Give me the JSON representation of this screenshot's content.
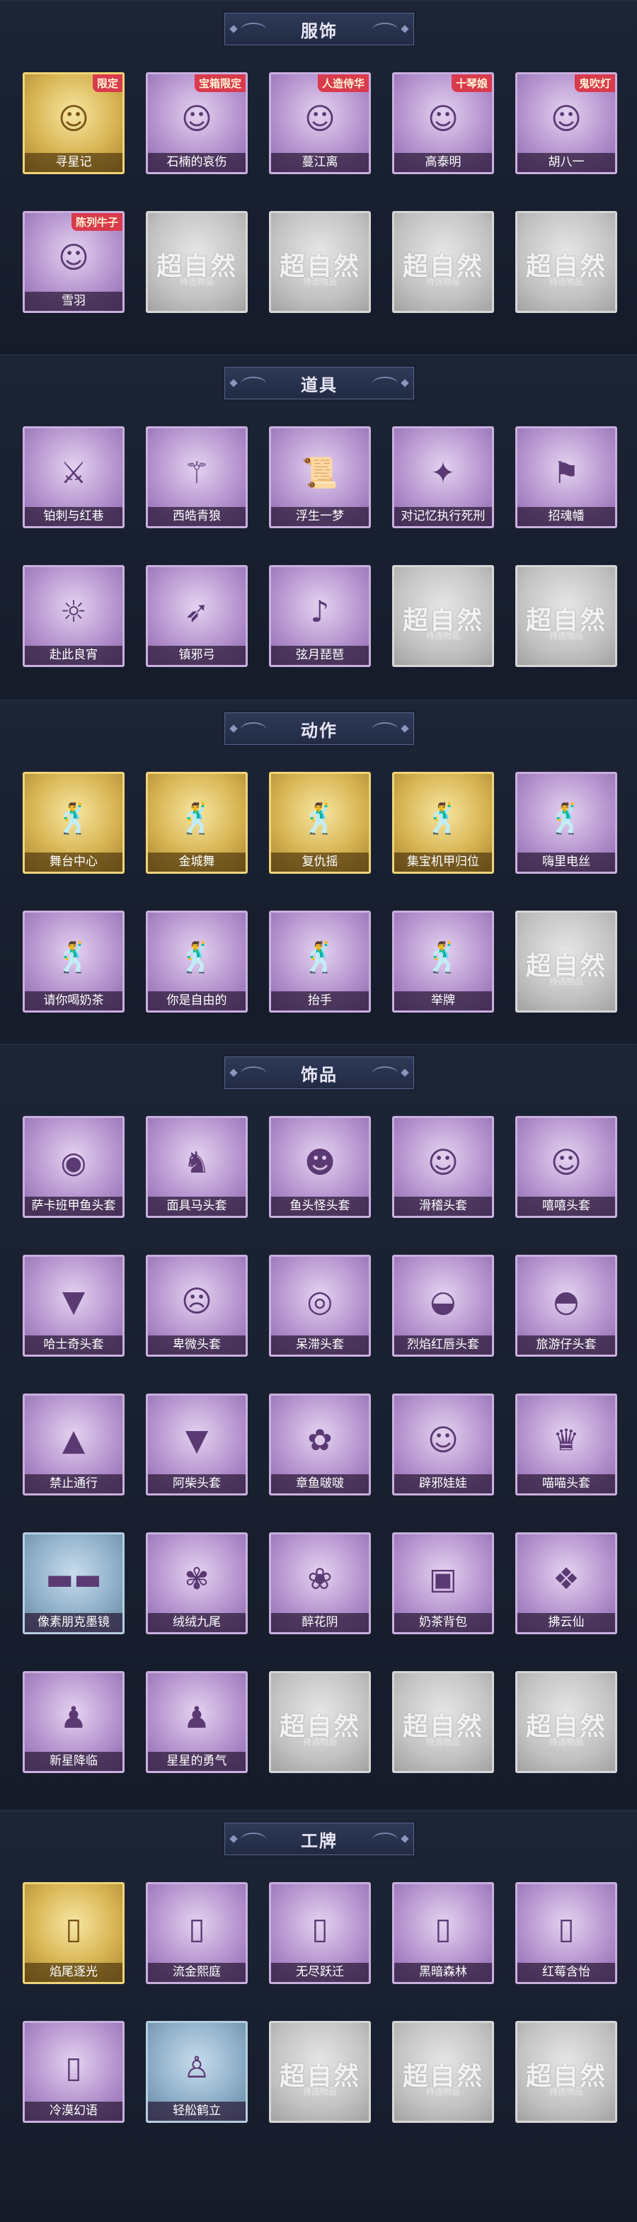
{
  "sections": [
    {
      "title": "服饰",
      "items": [
        {
          "label": "寻星记",
          "tier": "gold",
          "badge": "限定",
          "icon": "costume-portrait-icon"
        },
        {
          "label": "石楠的哀伤",
          "tier": "purple",
          "badge": "宝箱限定",
          "icon": "costume-portrait-icon"
        },
        {
          "label": "蔓江离",
          "tier": "purple",
          "badge": "人造侍华",
          "icon": "costume-portrait-icon"
        },
        {
          "label": "高泰明",
          "tier": "purple",
          "badge": "十琴娘",
          "icon": "costume-portrait-icon"
        },
        {
          "label": "胡八一",
          "tier": "purple",
          "badge": "鬼吹灯",
          "icon": "costume-portrait-icon"
        },
        {
          "label": "雪羽",
          "tier": "purple",
          "badge": "陈列牛子",
          "icon": "costume-portrait-icon"
        },
        {
          "label": "",
          "tier": "gray"
        },
        {
          "label": "",
          "tier": "gray"
        },
        {
          "label": "",
          "tier": "gray"
        },
        {
          "label": "",
          "tier": "gray"
        }
      ]
    },
    {
      "title": "道具",
      "items": [
        {
          "label": "铂刺与红巷",
          "tier": "purple",
          "icon": "blade-icon"
        },
        {
          "label": "西皓青狼",
          "tier": "purple",
          "icon": "staff-icon"
        },
        {
          "label": "浮生一梦",
          "tier": "purple",
          "icon": "scroll-icon"
        },
        {
          "label": "对记忆执行死刑",
          "tier": "purple",
          "icon": "gun-icon"
        },
        {
          "label": "招魂幡",
          "tier": "purple",
          "icon": "banner-icon"
        },
        {
          "label": "赴此良宵",
          "tier": "purple",
          "icon": "lantern-icon"
        },
        {
          "label": "镇邪弓",
          "tier": "purple",
          "icon": "bow-icon"
        },
        {
          "label": "弦月琵琶",
          "tier": "purple",
          "icon": "pipa-icon"
        },
        {
          "label": "",
          "tier": "gray"
        },
        {
          "label": "",
          "tier": "gray"
        }
      ]
    },
    {
      "title": "动作",
      "items": [
        {
          "label": "舞台中心",
          "tier": "gold",
          "icon": "pose-figure-icon"
        },
        {
          "label": "金城舞",
          "tier": "gold",
          "icon": "pose-figure-icon"
        },
        {
          "label": "复仇摇",
          "tier": "gold",
          "icon": "pose-figure-icon"
        },
        {
          "label": "集宝机甲归位",
          "tier": "gold",
          "icon": "pose-figure-icon"
        },
        {
          "label": "嗨里电丝",
          "tier": "purple",
          "icon": "pose-figure-icon"
        },
        {
          "label": "请你喝奶茶",
          "tier": "purple",
          "icon": "pose-figure-icon"
        },
        {
          "label": "你是自由的",
          "tier": "purple",
          "icon": "pose-figure-icon"
        },
        {
          "label": "抬手",
          "tier": "purple",
          "icon": "pose-figure-icon"
        },
        {
          "label": "举牌",
          "tier": "purple",
          "icon": "pose-figure-icon"
        },
        {
          "label": "",
          "tier": "gray"
        }
      ]
    },
    {
      "title": "饰品",
      "items": [
        {
          "label": "萨卡班甲鱼头套",
          "tier": "purple",
          "icon": "fish-head-icon"
        },
        {
          "label": "面具马头套",
          "tier": "purple",
          "icon": "horse-head-icon"
        },
        {
          "label": "鱼头怪头套",
          "tier": "purple",
          "icon": "fish-monster-head-icon"
        },
        {
          "label": "滑稽头套",
          "tier": "purple",
          "icon": "funny-face-icon"
        },
        {
          "label": "嘻嘻头套",
          "tier": "purple",
          "icon": "grin-face-icon"
        },
        {
          "label": "哈士奇头套",
          "tier": "purple",
          "icon": "husky-head-icon"
        },
        {
          "label": "卑微头套",
          "tier": "purple",
          "icon": "humble-face-icon"
        },
        {
          "label": "呆滞头套",
          "tier": "purple",
          "icon": "stunned-face-icon"
        },
        {
          "label": "烈焰红唇头套",
          "tier": "purple",
          "icon": "duck-head-icon"
        },
        {
          "label": "旅游仔头套",
          "tier": "purple",
          "icon": "tourist-head-icon"
        },
        {
          "label": "禁止通行",
          "tier": "purple",
          "icon": "traffic-cone-icon"
        },
        {
          "label": "阿柴头套",
          "tier": "purple",
          "icon": "shiba-head-icon"
        },
        {
          "label": "章鱼啵啵",
          "tier": "purple",
          "icon": "octopus-icon"
        },
        {
          "label": "辟邪娃娃",
          "tier": "purple",
          "icon": "doll-head-icon"
        },
        {
          "label": "喵喵头套",
          "tier": "purple",
          "icon": "cat-head-icon"
        },
        {
          "label": "像素朋克墨镜",
          "tier": "blue",
          "icon": "pixel-sunglasses-icon"
        },
        {
          "label": "绒绒九尾",
          "tier": "purple",
          "icon": "nine-tail-fox-icon"
        },
        {
          "label": "醉花阴",
          "tier": "purple",
          "icon": "hair-ornament-icon"
        },
        {
          "label": "奶茶背包",
          "tier": "purple",
          "icon": "bag-charm-icon"
        },
        {
          "label": "拂云仙",
          "tier": "purple",
          "icon": "charm-icon"
        },
        {
          "label": "新星降临",
          "tier": "purple",
          "icon": "figure-charm-icon"
        },
        {
          "label": "星星的勇气",
          "tier": "purple",
          "icon": "figure-charm-icon"
        },
        {
          "label": "",
          "tier": "gray"
        },
        {
          "label": "",
          "tier": "gray"
        },
        {
          "label": "",
          "tier": "gray"
        }
      ]
    },
    {
      "title": "工牌",
      "items": [
        {
          "label": "焰尾逐光",
          "tier": "gold",
          "icon": "badge-frame-icon"
        },
        {
          "label": "流金熙庭",
          "tier": "purple",
          "icon": "badge-frame-icon"
        },
        {
          "label": "无尽跃迁",
          "tier": "purple",
          "icon": "badge-frame-icon"
        },
        {
          "label": "黑暗森林",
          "tier": "purple",
          "icon": "badge-frame-icon"
        },
        {
          "label": "红莓含怡",
          "tier": "purple",
          "icon": "badge-frame-icon"
        },
        {
          "label": "冷漠幻语",
          "tier": "purple",
          "icon": "badge-frame-icon"
        },
        {
          "label": "轻舩鹤立",
          "tier": "blue",
          "icon": "silhouette-icon"
        },
        {
          "label": "",
          "tier": "gray"
        },
        {
          "label": "",
          "tier": "gray"
        },
        {
          "label": "",
          "tier": "gray"
        }
      ]
    }
  ],
  "placeholder": {
    "main": "超自然",
    "sub": "待选物品"
  }
}
